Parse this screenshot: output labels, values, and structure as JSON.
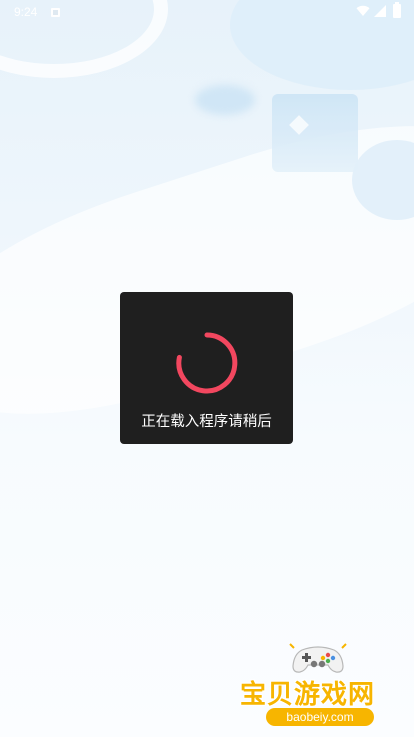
{
  "status_bar": {
    "time": "9:24"
  },
  "loading": {
    "message": "正在载入程序请稍后",
    "accent_color": "#f2475f"
  },
  "watermark": {
    "title": "宝贝游戏网",
    "domain": "baobeiy.com"
  }
}
